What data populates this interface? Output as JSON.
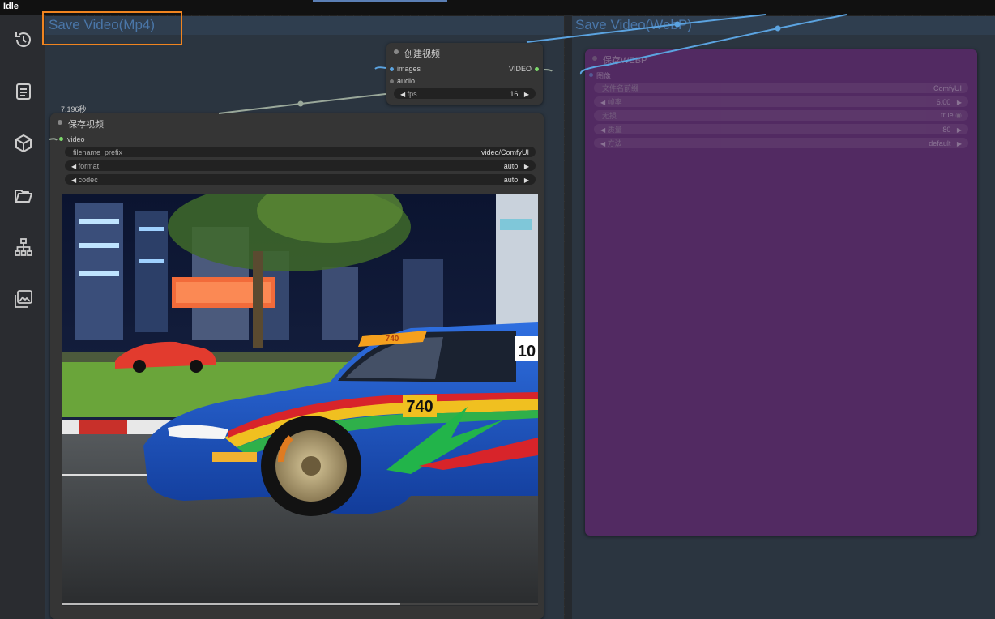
{
  "app": {
    "title": "Idle"
  },
  "sidebar": {
    "items": [
      {
        "icon": "history-icon"
      },
      {
        "icon": "document-icon"
      },
      {
        "icon": "cube-icon"
      },
      {
        "icon": "folder-icon"
      },
      {
        "icon": "workflow-icon"
      },
      {
        "icon": "image-gallery-icon"
      }
    ]
  },
  "groups": {
    "mp4": {
      "title": "Save Video(Mp4)"
    },
    "webp": {
      "title": "Save Video(WebP)"
    }
  },
  "create_video_node": {
    "title": "创建视频",
    "inputs": [
      "images",
      "audio"
    ],
    "output": "VIDEO",
    "fps": {
      "label": "fps",
      "value": "16"
    }
  },
  "save_video_node": {
    "duration": "7.196秒",
    "title": "保存视频",
    "input": "video",
    "widgets": [
      {
        "label": "filename_prefix",
        "value": "video/ComfyUI"
      },
      {
        "label": "format",
        "value": "auto"
      },
      {
        "label": "codec",
        "value": "auto"
      }
    ],
    "playback_progress": 0.71,
    "car_number": "740"
  },
  "webp_node": {
    "title": "保存WEBP",
    "input": "图像",
    "widgets": [
      {
        "label": "文件名前缀",
        "value": "ComfyUI"
      },
      {
        "label": "帧率",
        "value": "6.00"
      },
      {
        "label": "无损",
        "value": "true"
      },
      {
        "label": "质量",
        "value": "80"
      },
      {
        "label": "方法",
        "value": "default"
      }
    ]
  },
  "colors": {
    "highlight": "#f0841f",
    "group_title": "#4a76a8",
    "webp_node_bg": "#522a62",
    "link_blue": "#5ba3e0",
    "link_gray": "#9aa89a"
  }
}
